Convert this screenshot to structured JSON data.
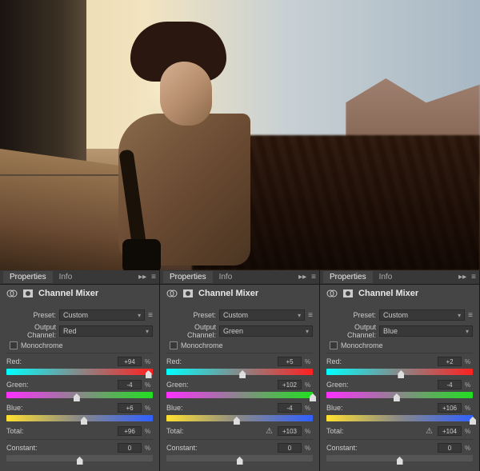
{
  "tabs": {
    "properties": "Properties",
    "info": "Info"
  },
  "panel_title": "Channel Mixer",
  "labels": {
    "preset": "Preset:",
    "output_channel": "Output Channel:",
    "monochrome": "Monochrome",
    "red": "Red:",
    "green": "Green:",
    "blue": "Blue:",
    "total": "Total:",
    "constant": "Constant:",
    "pct": "%"
  },
  "panels": [
    {
      "preset": "Custom",
      "output_channel": "Red",
      "monochrome": false,
      "red": {
        "value": "+94",
        "pos": 97
      },
      "green": {
        "value": "-4",
        "pos": 48
      },
      "blue": {
        "value": "+6",
        "pos": 53
      },
      "total": {
        "value": "+96",
        "warn": false
      },
      "constant": {
        "value": "0",
        "pos": 50
      }
    },
    {
      "preset": "Custom",
      "output_channel": "Green",
      "monochrome": false,
      "red": {
        "value": "+5",
        "pos": 52
      },
      "green": {
        "value": "+102",
        "pos": 100
      },
      "blue": {
        "value": "-4",
        "pos": 48
      },
      "total": {
        "value": "+103",
        "warn": true
      },
      "constant": {
        "value": "0",
        "pos": 50
      }
    },
    {
      "preset": "Custom",
      "output_channel": "Blue",
      "monochrome": false,
      "red": {
        "value": "+2",
        "pos": 51
      },
      "green": {
        "value": "-4",
        "pos": 48
      },
      "blue": {
        "value": "+106",
        "pos": 100
      },
      "total": {
        "value": "+104",
        "warn": true
      },
      "constant": {
        "value": "0",
        "pos": 50
      }
    }
  ]
}
